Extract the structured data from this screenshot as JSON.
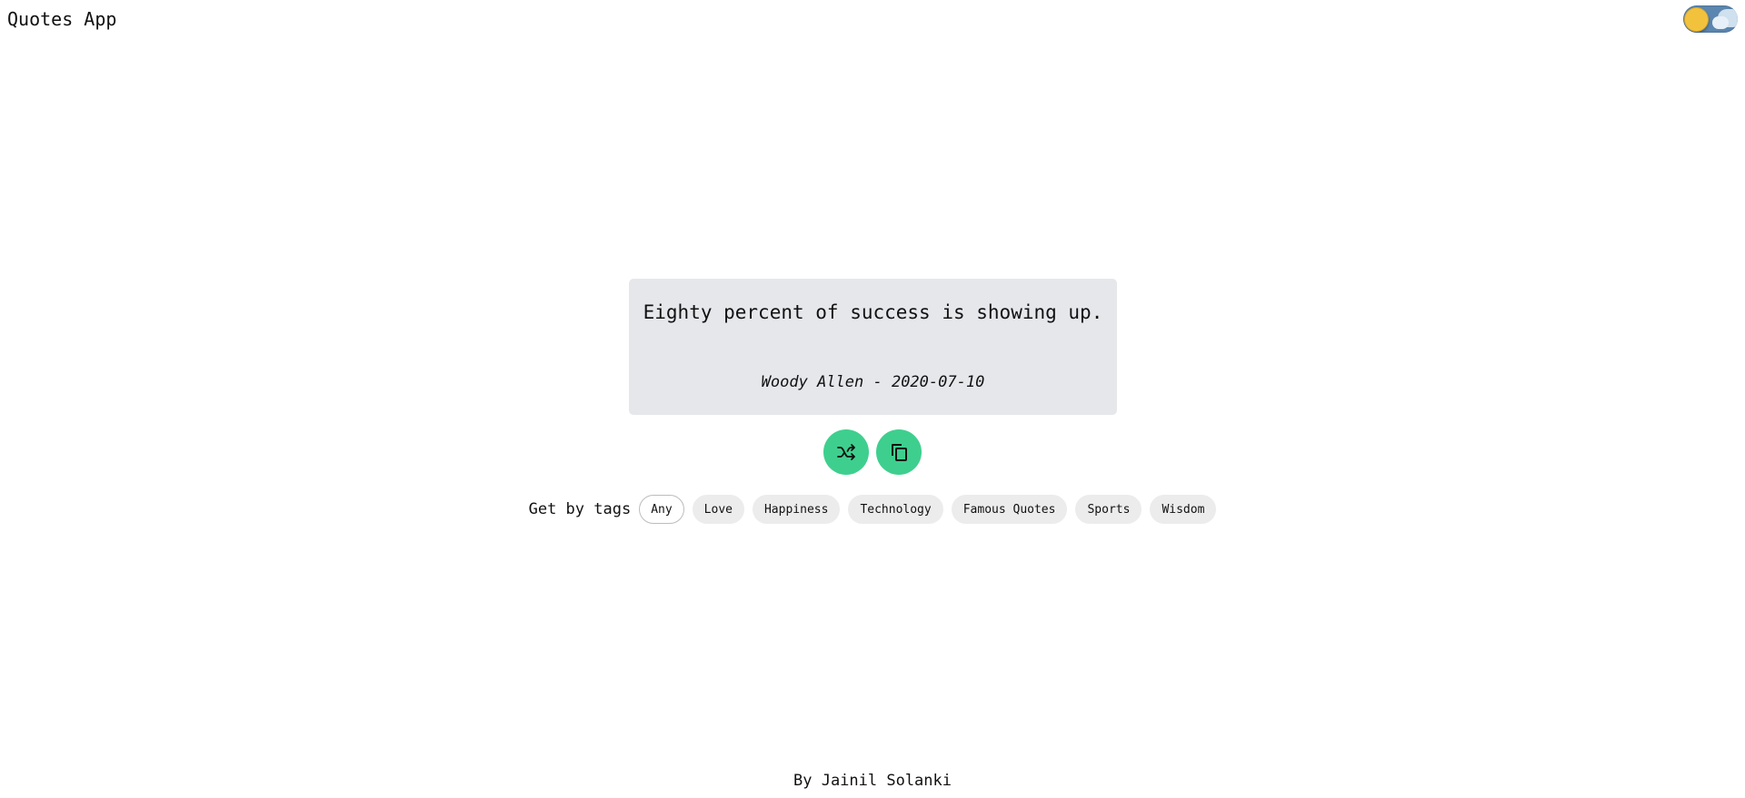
{
  "header": {
    "title": "Quotes App",
    "theme_toggle": {
      "mode": "light",
      "icon": "sun-icon"
    }
  },
  "quote": {
    "text": "Eighty percent of success is showing up.",
    "meta": "Woody Allen - 2020-07-10"
  },
  "actions": {
    "shuffle_icon": "shuffle-icon",
    "copy_icon": "copy-icon",
    "accent_color": "#3ecf8e"
  },
  "tags": {
    "label": "Get by tags",
    "selected": "Any",
    "items": [
      "Any",
      "Love",
      "Happiness",
      "Technology",
      "Famous Quotes",
      "Sports",
      "Wisdom"
    ]
  },
  "footer": {
    "text": "By Jainil Solanki"
  }
}
